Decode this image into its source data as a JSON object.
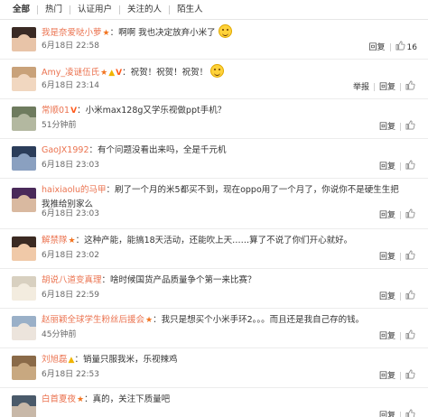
{
  "tabs": [
    "全部",
    "热门",
    "认证用户",
    "关注的人",
    "陌生人"
  ],
  "actions": {
    "report": "举报",
    "reply": "回复"
  },
  "comments": [
    {
      "user": "我是奈爱哒小萝",
      "badges": [
        "★"
      ],
      "text": "：啊啊 我也决定放弃小米了",
      "emoji": true,
      "time": "6月18日 22:58",
      "report": false,
      "likes": "16",
      "avatar": [
        "#3a2a24",
        "#e8c4a8"
      ]
    },
    {
      "user": "Amy_凌谜伍氏",
      "badges": [
        "★",
        "▲",
        "V"
      ],
      "text": "：祝贺！祝贺！祝贺！",
      "emoji": true,
      "time": "6月18日 23:14",
      "report": true,
      "likes": "",
      "avatar": [
        "#c9a27a",
        "#f1d7c0"
      ]
    },
    {
      "user": "常顺01",
      "badges": [
        "V"
      ],
      "text": "：小米max128g又学乐视做ppt手机？",
      "emoji": false,
      "time": "51分钟前",
      "report": false,
      "likes": "",
      "avatar": [
        "#6e7b5e",
        "#b3b8a0"
      ]
    },
    {
      "user": "GaoJX1992",
      "badges": [],
      "text": "：有个问题没看出来吗，全是千元机",
      "emoji": false,
      "time": "6月18日 23:03",
      "report": false,
      "likes": "",
      "avatar": [
        "#2b3d5a",
        "#8aa0c0"
      ]
    },
    {
      "user": "haixiaolu的马甲",
      "badges": [],
      "text": "：刷了一个月的米5都买不到，现在oppo用了一个月了，你说你不是硬生生把我推给别家么",
      "emoji": false,
      "time": "6月18日 23:03",
      "report": false,
      "likes": "",
      "avatar": [
        "#4a2a5a",
        "#d9b9a0"
      ],
      "wrap": true
    },
    {
      "user": "解禁隊",
      "badges": [
        "★"
      ],
      "text": "：这种产能，能搞18天活动，还能吹上天……算了不说了你们开心就好。",
      "emoji": false,
      "time": "6月18日 23:02",
      "report": false,
      "likes": "",
      "avatar": [
        "#3b2a22",
        "#f0c9a8"
      ]
    },
    {
      "user": "胡说八道变真理",
      "badges": [],
      "text": "：啥时候国货产品质量争个第一来比赛？",
      "emoji": false,
      "time": "6月18日 22:59",
      "report": false,
      "likes": "",
      "avatar": [
        "#d8d0c0",
        "#f3ecdf"
      ]
    },
    {
      "user": "赵丽颖全球学生粉丝后援会",
      "badges": [
        "★"
      ],
      "text": "：我只是想买个小米手环2。。。而且还是我自己存的钱。",
      "emoji": false,
      "time": "45分钟前",
      "report": false,
      "likes": "",
      "avatar": [
        "#9ab0c8",
        "#ece4dc"
      ]
    },
    {
      "user": "刘旭磊",
      "badges": [
        "▲"
      ],
      "text": "：销量只服我米，乐视辣鸡",
      "emoji": false,
      "time": "6月18日 22:53",
      "report": false,
      "likes": "",
      "avatar": [
        "#8a6a48",
        "#c8a880"
      ]
    },
    {
      "user": "白首夏夜",
      "badges": [
        "★"
      ],
      "text": "：真的，关注下质量吧",
      "emoji": false,
      "time": "",
      "report": false,
      "likes": "",
      "avatar": [
        "#4a5a6a",
        "#c8b8a8"
      ]
    }
  ]
}
